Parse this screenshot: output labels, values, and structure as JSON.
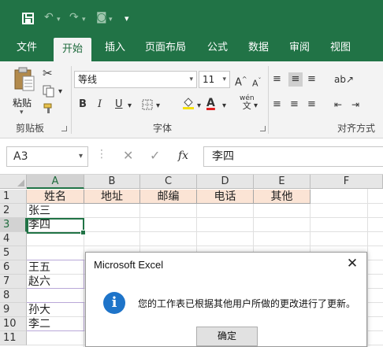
{
  "quick_access": {
    "undo": "↶",
    "redo": "↷",
    "camera": "◙",
    "more": "▾"
  },
  "tabs": [
    "文件",
    "开始",
    "插入",
    "页面布局",
    "公式",
    "数据",
    "审阅",
    "视图"
  ],
  "ribbon": {
    "clipboard": {
      "paste_label": "粘贴",
      "group_label": "剪贴板"
    },
    "font": {
      "name": "等线",
      "size": "11",
      "grow": "A",
      "shrink": "A",
      "bold": "B",
      "italic": "I",
      "underline": "U",
      "wen": "wén",
      "group_label": "字体"
    },
    "alignment": {
      "group_label": "对齐方式"
    }
  },
  "name_box": "A3",
  "formula_bar": {
    "cancel": "✕",
    "enter": "✓",
    "fx": "fx",
    "value": "李四"
  },
  "columns": [
    "A",
    "B",
    "C",
    "D",
    "E",
    "F"
  ],
  "rows": [
    "1",
    "2",
    "3",
    "4",
    "5",
    "6",
    "7",
    "8",
    "9",
    "10",
    "11"
  ],
  "sheet": {
    "headers": [
      "姓名",
      "地址",
      "邮编",
      "电话",
      "其他"
    ],
    "a2": "张三",
    "a3": "李四",
    "a6": "王五",
    "a7": "赵六",
    "a9": "孙大",
    "a10": "李二"
  },
  "dialog": {
    "title": "Microsoft Excel",
    "close": "✕",
    "icon": "i",
    "message": "您的工作表已根据其他用户所做的更改进行了更新。",
    "ok": "确定"
  },
  "colors": {
    "accent": "#217346",
    "header_fill": "#fbe4d5",
    "info": "#1e74c9"
  }
}
